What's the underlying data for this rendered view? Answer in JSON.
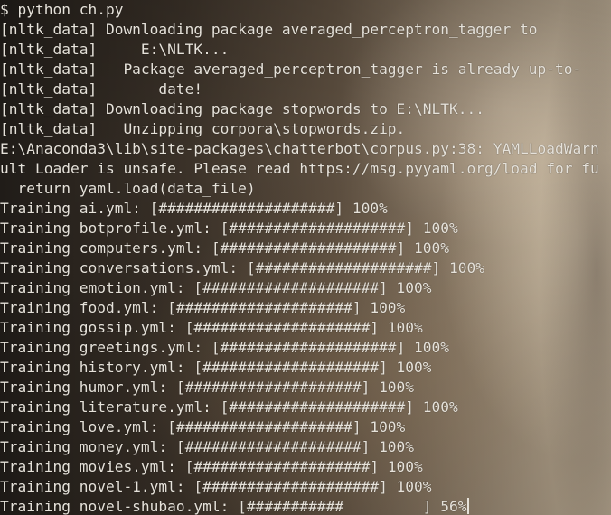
{
  "terminal": {
    "lines": [
      "$ python ch.py",
      "[nltk_data] Downloading package averaged_perceptron_tagger to",
      "[nltk_data]     E:\\NLTK...",
      "[nltk_data]   Package averaged_perceptron_tagger is already up-to-",
      "[nltk_data]       date!",
      "[nltk_data] Downloading package stopwords to E:\\NLTK...",
      "[nltk_data]   Unzipping corpora\\stopwords.zip.",
      "E:\\Anaconda3\\lib\\site-packages\\chatterbot\\corpus.py:38: YAMLLoadWarn",
      "ult Loader is unsafe. Please read https://msg.pyyaml.org/load for fu",
      "  return yaml.load(data_file)",
      "Training ai.yml: [####################] 100%",
      "Training botprofile.yml: [####################] 100%",
      "Training computers.yml: [####################] 100%",
      "Training conversations.yml: [####################] 100%",
      "Training emotion.yml: [####################] 100%",
      "Training food.yml: [####################] 100%",
      "Training gossip.yml: [####################] 100%",
      "Training greetings.yml: [####################] 100%",
      "Training history.yml: [####################] 100%",
      "Training humor.yml: [####################] 100%",
      "Training literature.yml: [####################] 100%",
      "Training love.yml: [####################] 100%",
      "Training money.yml: [####################] 100%",
      "Training movies.yml: [####################] 100%",
      "Training novel-1.yml: [####################] 100%",
      "Training novel-shubao.yml: [###########         ] 56%"
    ]
  }
}
